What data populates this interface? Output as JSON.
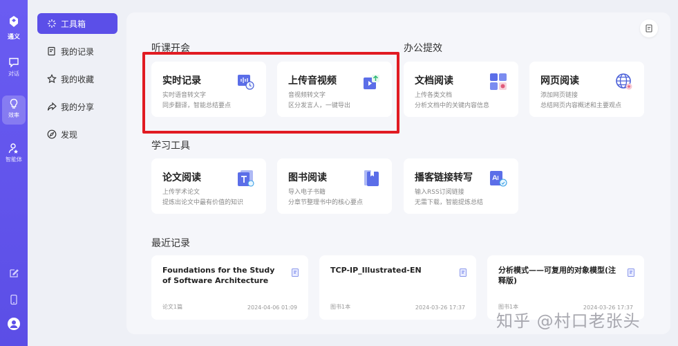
{
  "rail": {
    "logo_text": "通义",
    "items": [
      {
        "label": "对话"
      },
      {
        "label": "效率"
      },
      {
        "label": "智能体"
      }
    ]
  },
  "nav": {
    "items": [
      {
        "label": "工具箱"
      },
      {
        "label": "我的记录"
      },
      {
        "label": "我的收藏"
      },
      {
        "label": "我的分享"
      },
      {
        "label": "发现"
      }
    ]
  },
  "sections": {
    "listen": "听课开会",
    "office": "办公提效",
    "study": "学习工具",
    "recent": "最近记录"
  },
  "cards": {
    "realtime": {
      "title": "实时记录",
      "d1": "实时语音转文字",
      "d2": "同步翻译，智能总结要点"
    },
    "upload": {
      "title": "上传音视频",
      "d1": "音视频转文字",
      "d2": "区分发言人，一键导出"
    },
    "doc": {
      "title": "文档阅读",
      "d1": "上传各类文档",
      "d2": "分析文档中的关键内容信息"
    },
    "web": {
      "title": "网页阅读",
      "d1": "添加网页链接",
      "d2": "总结网页内容概述和主要观点"
    },
    "paper": {
      "title": "论文阅读",
      "d1": "上传学术论文",
      "d2": "提炼出论文中最有价值的知识"
    },
    "book": {
      "title": "图书阅读",
      "d1": "导入电子书籍",
      "d2": "分章节整理书中的核心要点"
    },
    "podcast": {
      "title": "播客链接转写",
      "d1": "输入RSS订阅链接",
      "d2": "无需下载，智能提炼总结"
    }
  },
  "recent": [
    {
      "title": "Foundations for the Study of Software Architecture",
      "meta": "论文1篇",
      "date": "2024-04-06 01:09"
    },
    {
      "title": "TCP-IP_Illustrated-EN",
      "meta": "图书1本",
      "date": "2024-03-26 17:37"
    },
    {
      "title": "分析模式——可复用的对象模型(注释版)",
      "meta": "图书1本",
      "date": "2024-03-26 17:37"
    }
  ],
  "watermark": "知乎 @村口老张头",
  "colors": {
    "accent": "#5b4fe8",
    "highlight": "#e11b22"
  }
}
